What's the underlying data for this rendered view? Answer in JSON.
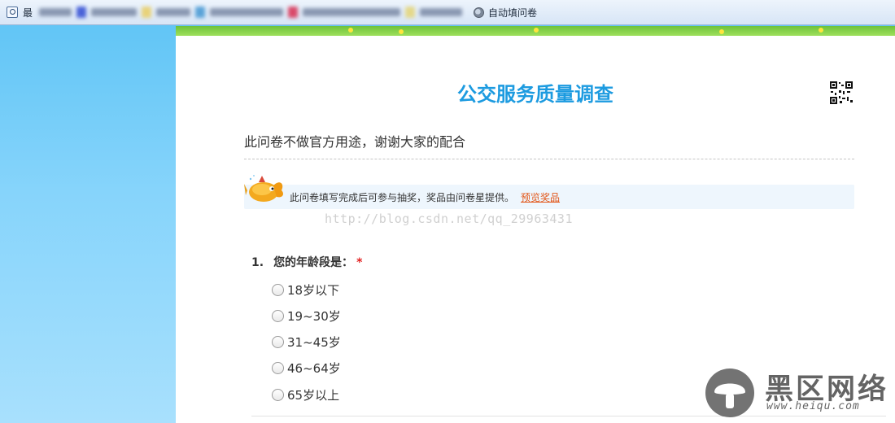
{
  "favorites_bar": {
    "truncated_item": "最",
    "auto_fill_label": "自动填问卷"
  },
  "survey": {
    "title": "公交服务质量调查",
    "description": "此问卷不做官方用途，谢谢大家的配合",
    "prize_text": "此问卷填写完成后可参与抽奖，奖品由问卷星提供。",
    "prize_link": "预览奖品",
    "watermark_url": "http://blog.csdn.net/qq_29963431",
    "question": {
      "number": "1.",
      "text": "您的年龄段是：",
      "required_mark": "*",
      "options": [
        "18岁以下",
        "19~30岁",
        "31~45岁",
        "46~64岁",
        "65岁以上"
      ]
    }
  },
  "site_watermark": {
    "name": "黑区网络",
    "url": "www.heiqu.com"
  },
  "colors": {
    "title": "#1d9be0",
    "prize_link": "#e2571a",
    "required": "#e32020",
    "sky": "#6fcbf8"
  }
}
